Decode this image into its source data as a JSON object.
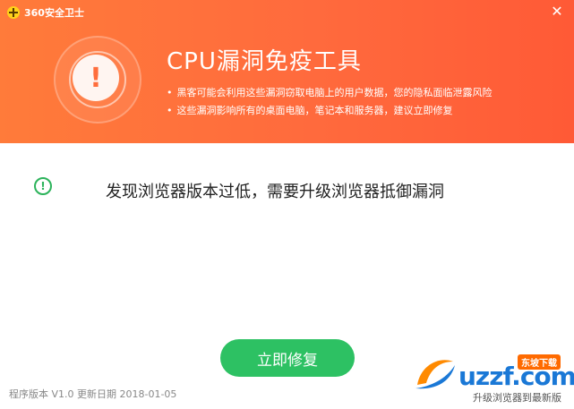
{
  "app": {
    "title": "360安全卫士",
    "close_glyph": "✕"
  },
  "header": {
    "headline": "CPU漏洞免疫工具",
    "bullets": [
      "黑客可能会利用这些漏洞窃取电脑上的用户数据，您的隐私面临泄露风险",
      "这些漏洞影响所有的桌面电脑，笔记本和服务器，建议立即修复"
    ],
    "icon": "warning-icon",
    "warning_glyph": "!"
  },
  "status": {
    "icon": "info-icon",
    "glyph": "!",
    "text": "发现浏览器版本过低，需要升级浏览器抵御漏洞"
  },
  "action": {
    "fix_label": "立即修复"
  },
  "footer": {
    "version_info": "程序版本 V1.0 更新日期 2018-01-05"
  },
  "watermark": {
    "brand": "uzzf.com",
    "badge": "东坡下载",
    "sub": "升级浏览器到最新版"
  },
  "colors": {
    "header": "#ff6a3d",
    "accent_green": "#2dc163",
    "status_green": "#2cb35b"
  }
}
